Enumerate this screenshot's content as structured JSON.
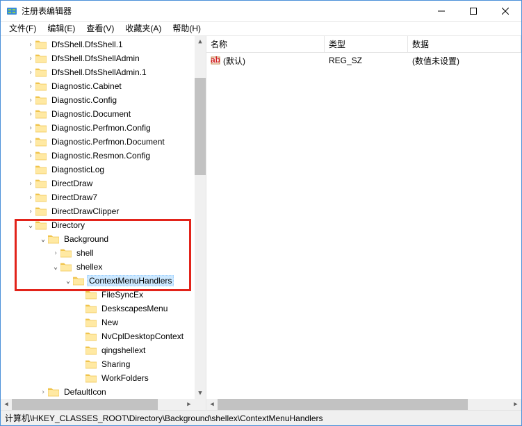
{
  "window": {
    "title": "注册表编辑器"
  },
  "menu": {
    "file": "文件(F)",
    "edit": "编辑(E)",
    "view": "查看(V)",
    "favorites": "收藏夹(A)",
    "help": "帮助(H)"
  },
  "tree": {
    "items": [
      {
        "indent": 2,
        "chev": ">",
        "label": "DfsShell.DfsShell.1"
      },
      {
        "indent": 2,
        "chev": ">",
        "label": "DfsShell.DfsShellAdmin"
      },
      {
        "indent": 2,
        "chev": ">",
        "label": "DfsShell.DfsShellAdmin.1"
      },
      {
        "indent": 2,
        "chev": ">",
        "label": "Diagnostic.Cabinet"
      },
      {
        "indent": 2,
        "chev": ">",
        "label": "Diagnostic.Config"
      },
      {
        "indent": 2,
        "chev": ">",
        "label": "Diagnostic.Document"
      },
      {
        "indent": 2,
        "chev": ">",
        "label": "Diagnostic.Perfmon.Config"
      },
      {
        "indent": 2,
        "chev": ">",
        "label": "Diagnostic.Perfmon.Document"
      },
      {
        "indent": 2,
        "chev": ">",
        "label": "Diagnostic.Resmon.Config"
      },
      {
        "indent": 2,
        "chev": "",
        "label": "DiagnosticLog"
      },
      {
        "indent": 2,
        "chev": ">",
        "label": "DirectDraw"
      },
      {
        "indent": 2,
        "chev": ">",
        "label": "DirectDraw7"
      },
      {
        "indent": 2,
        "chev": ">",
        "label": "DirectDrawClipper"
      },
      {
        "indent": 2,
        "chev": "v",
        "label": "Directory"
      },
      {
        "indent": 3,
        "chev": "v",
        "label": "Background"
      },
      {
        "indent": 4,
        "chev": ">",
        "label": "shell"
      },
      {
        "indent": 4,
        "chev": "v",
        "label": "shellex"
      },
      {
        "indent": 5,
        "chev": "v",
        "label": "ContextMenuHandlers",
        "selected": true
      },
      {
        "indent": 6,
        "chev": "",
        "label": "FileSyncEx"
      },
      {
        "indent": 6,
        "chev": "",
        "label": "DeskscapesMenu"
      },
      {
        "indent": 6,
        "chev": "",
        "label": "New"
      },
      {
        "indent": 6,
        "chev": "",
        "label": "NvCplDesktopContext"
      },
      {
        "indent": 6,
        "chev": "",
        "label": "qingshellext"
      },
      {
        "indent": 6,
        "chev": "",
        "label": "Sharing"
      },
      {
        "indent": 6,
        "chev": "",
        "label": "WorkFolders"
      },
      {
        "indent": 3,
        "chev": ">",
        "label": "DefaultIcon"
      }
    ]
  },
  "list": {
    "headers": {
      "name": "名称",
      "type": "类型",
      "data": "数据"
    },
    "rows": [
      {
        "name": "(默认)",
        "type": "REG_SZ",
        "data": "(数值未设置)"
      }
    ]
  },
  "status": {
    "path": "计算机\\HKEY_CLASSES_ROOT\\Directory\\Background\\shellex\\ContextMenuHandlers"
  },
  "colors": {
    "folder_light": "#ffe9a3",
    "folder_dark": "#f0c44c"
  }
}
